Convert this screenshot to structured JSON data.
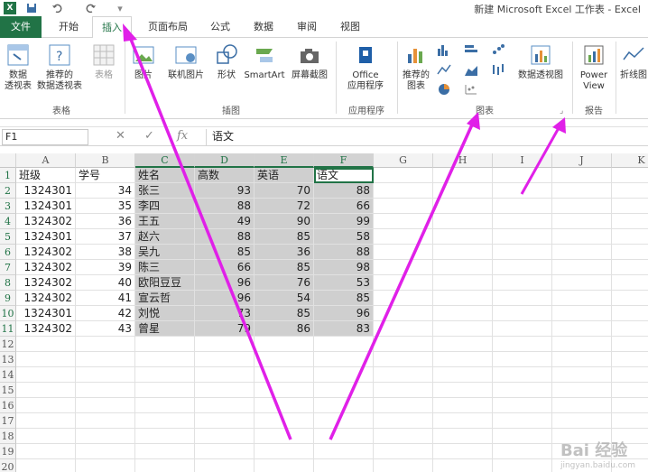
{
  "window": {
    "title": "新建 Microsoft Excel 工作表 - Excel",
    "quick_access_more": "▾"
  },
  "tabs": [
    {
      "label": "文件"
    },
    {
      "label": "开始"
    },
    {
      "label": "插入"
    },
    {
      "label": "页面布局"
    },
    {
      "label": "公式"
    },
    {
      "label": "数据"
    },
    {
      "label": "审阅"
    },
    {
      "label": "视图"
    }
  ],
  "ribbon": {
    "tables": {
      "pivot_table": "数据\n透视表",
      "recommended_pivot": "推荐的\n数据透视表",
      "table": "表格",
      "group": "表格"
    },
    "illustrations": {
      "pictures": "图片",
      "online_pictures": "联机图片",
      "shapes": "形状",
      "smartart": "SmartArt",
      "screenshot": "屏幕截图",
      "group": "插图"
    },
    "apps": {
      "office_apps": "Office\n应用程序",
      "group": "应用程序"
    },
    "charts": {
      "recommended_charts": "推荐的\n图表",
      "pivot_chart": "数据透视图",
      "group": "图表"
    },
    "reports": {
      "power_view": "Power\nView",
      "group": "报告"
    },
    "sparklines": {
      "line": "折线图"
    }
  },
  "formula_bar": {
    "name_box": "F1",
    "fx": "fx",
    "content": "语文"
  },
  "sheet": {
    "columns": [
      "A",
      "B",
      "C",
      "D",
      "E",
      "F",
      "G",
      "H",
      "I",
      "J",
      "K"
    ],
    "row_numbers": [
      "1",
      "2",
      "3",
      "4",
      "5",
      "6",
      "7",
      "8",
      "9",
      "10",
      "11",
      "12",
      "13",
      "14",
      "15",
      "16",
      "17",
      "18",
      "19",
      "20"
    ],
    "header": [
      "班级",
      "学号",
      "姓名",
      "高数",
      "英语",
      "语文"
    ],
    "rows": [
      [
        "1324301",
        "34",
        "张三",
        "93",
        "70",
        "88"
      ],
      [
        "1324301",
        "35",
        "李四",
        "88",
        "72",
        "66"
      ],
      [
        "1324302",
        "36",
        "王五",
        "49",
        "90",
        "99"
      ],
      [
        "1324301",
        "37",
        "赵六",
        "88",
        "85",
        "58"
      ],
      [
        "1324302",
        "38",
        "吴九",
        "85",
        "36",
        "88"
      ],
      [
        "1324302",
        "39",
        "陈三",
        "66",
        "85",
        "98"
      ],
      [
        "1324302",
        "40",
        "欧阳豆豆",
        "96",
        "76",
        "53"
      ],
      [
        "1324302",
        "41",
        "宣云哲",
        "96",
        "54",
        "85"
      ],
      [
        "1324301",
        "42",
        "刘悦",
        "73",
        "85",
        "96"
      ],
      [
        "1324302",
        "43",
        "曾星",
        "79",
        "86",
        "83"
      ]
    ]
  },
  "watermark": {
    "brand": "Bai 经验",
    "url": "jingyan.baidu.com"
  },
  "colors": {
    "excel_green": "#217346",
    "arrow": "#e020e8",
    "selection": "#cfcfcf"
  }
}
